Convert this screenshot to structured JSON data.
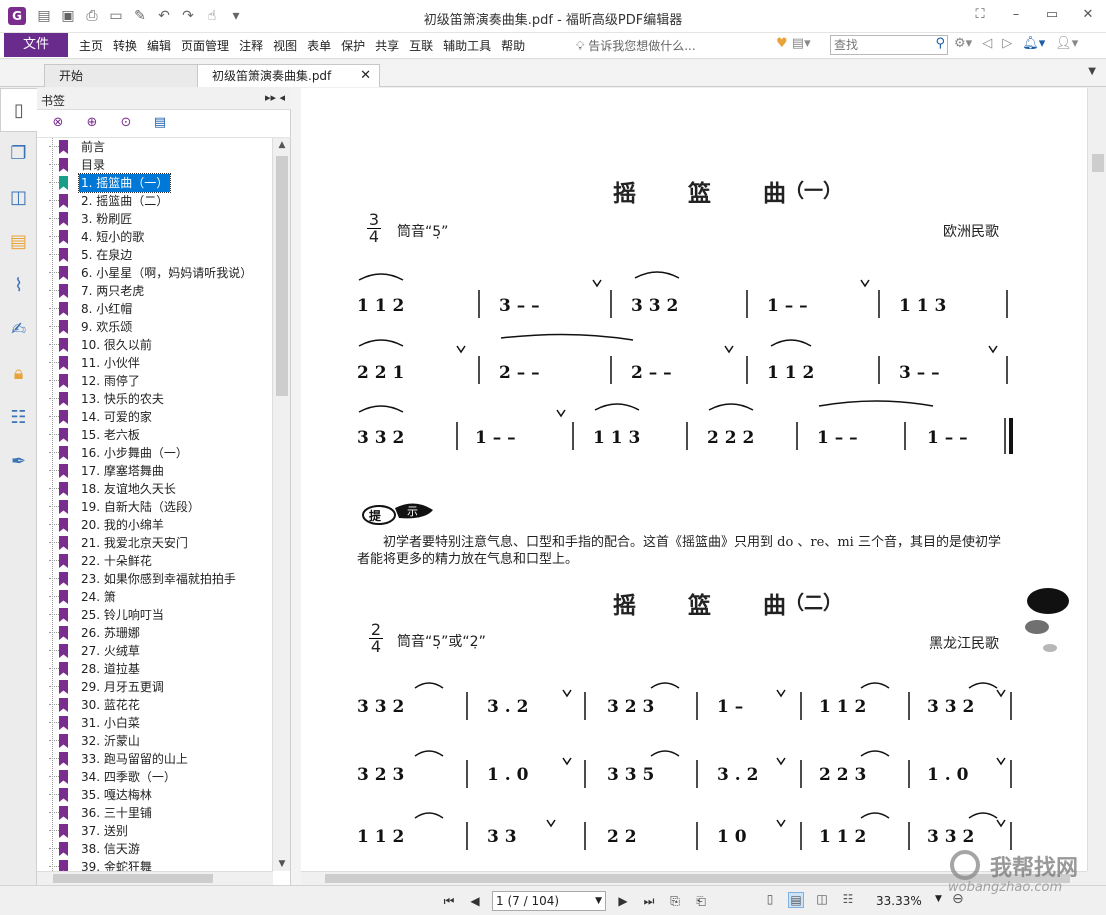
{
  "window": {
    "title": "初级笛箫演奏曲集.pdf - 福昕高级PDF编辑器"
  },
  "menu": {
    "file": "文件",
    "items": [
      "主页",
      "转换",
      "编辑",
      "页面管理",
      "注释",
      "视图",
      "表单",
      "保护",
      "共享",
      "互联",
      "辅助工具",
      "帮助"
    ],
    "tell_me": "告诉我您想做什么...",
    "search_placeholder": "查找"
  },
  "tabs": [
    {
      "label": "开始",
      "active": false
    },
    {
      "label": "初级笛箫演奏曲集.pdf",
      "active": true
    }
  ],
  "bookmarks": {
    "title": "书签",
    "items": [
      "前言",
      "目录",
      "1. 摇篮曲（一）",
      "2. 摇篮曲（二）",
      "3. 粉刷匠",
      "4. 短小的歌",
      "5. 在泉边",
      "6. 小星星（啊，妈妈请听我说）",
      "7. 两只老虎",
      "8. 小红帽",
      "9. 欢乐颂",
      "10. 很久以前",
      "11. 小伙伴",
      "12. 雨停了",
      "13. 快乐的农夫",
      "14. 可爱的家",
      "15. 老六板",
      "16. 小步舞曲（一）",
      "17. 摩塞塔舞曲",
      "18. 友谊地久天长",
      "19. 自新大陆（选段）",
      "20. 我的小绵羊",
      "21. 我爱北京天安门",
      "22. 十朵鲜花",
      "23. 如果你感到幸福就拍拍手",
      "24. 箫",
      "25. 铃儿响叮当",
      "26. 苏珊娜",
      "27. 火绒草",
      "28. 道拉基",
      "29. 月牙五更调",
      "30. 蓝花花",
      "31. 小白菜",
      "32. 沂蒙山",
      "33. 跑马留留的山上",
      "34. 四季歌（一）",
      "35. 嘎达梅林",
      "36. 三十里铺",
      "37. 送别",
      "38. 信天游",
      "39. 金蛇狂舞"
    ],
    "selected_index": 2
  },
  "page": {
    "song1": {
      "title": "摇 篮 曲",
      "part": "（一）",
      "time_top": "3",
      "time_bottom": "4",
      "key": "筒音“5̣”",
      "origin": "欧洲民歌",
      "rows": [
        "1   1   2 | 3  –  –∨ | 3   3   2 | 1  –  –∨ | 1   1   3 |",
        "2   2   1∨| 2  –  –  | 2  –  –∨ | 1   1   2 | 3  –  –∨ |",
        "3   3   2 | 1  –  –∨ | 1   1   3 | 2   2   2 | 1  –  – | 1  –  – ‖"
      ]
    },
    "tip": {
      "label": "提示",
      "text": "初学者要特别注意气息、口型和手指的配合。这首《摇篮曲》只用到 do 、re、mi 三个音，其目的是使初学者能将更多的精力放在气息和口型上。"
    },
    "song2": {
      "title": "摇 篮 曲",
      "part": "（二）",
      "time_top": "2",
      "time_bottom": "4",
      "key": "筒音“5̣”或“2̣”",
      "origin": "黑龙江民歌",
      "rows": [
        "3    3 2 | 3.   2∨ | 3   2 3 | 1   –∨ | 1   1 2 | 3   3 2∨|",
        "3    2 3 | 1.   0∨ | 3   3 5 | 3.   2∨| 2   2 3 | 1.   0∨ |",
        "1    1 2 | 3    3∨ | 2    2  | 1    0∨| 1   1 2 | 3   3 2∨|"
      ]
    }
  },
  "status": {
    "page_indicator": "1 (7 / 104)",
    "zoom": "33.33%"
  },
  "watermark": {
    "text": "我帮找网",
    "url": "wobangzhao.com"
  }
}
